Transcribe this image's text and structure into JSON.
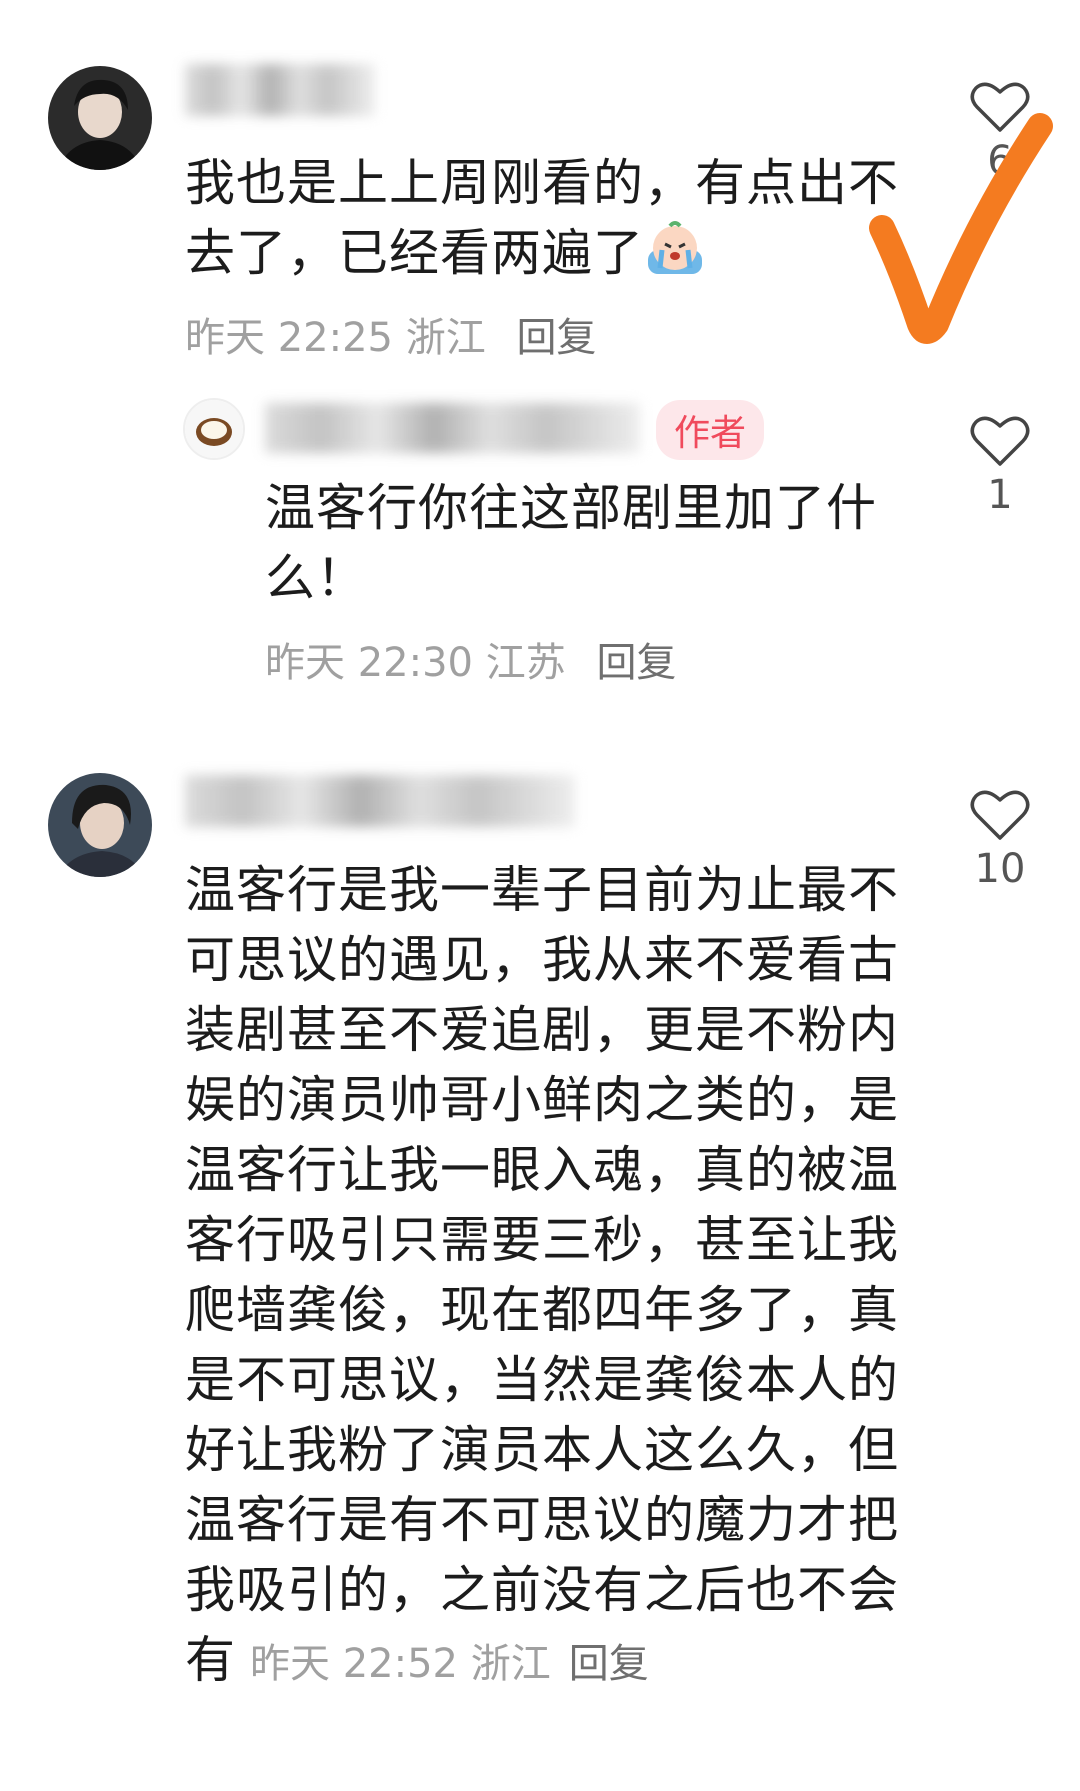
{
  "comments": [
    {
      "content": "我也是上上周刚看的，有点出不去了，已经看两遍了",
      "emoji": "crying-face-emoji",
      "time": "昨天 22:25",
      "location": "浙江",
      "reply_label": "回复",
      "likes": "6"
    },
    {
      "author_tag": "作者",
      "content": "温客行你往这部剧里加了什么！",
      "time": "昨天 22:30",
      "location": "江苏",
      "reply_label": "回复",
      "likes": "1"
    },
    {
      "content": "温客行是我一辈子目前为止最不可思议的遇见，我从来不爱看古装剧甚至不爱追剧，更是不粉内娱的演员帅哥小鲜肉之类的，是温客行让我一眼入魂，真的被温客行吸引只需要三秒，甚至让我爬墙龚俊，现在都四年多了，真是不可思议，当然是龚俊本人的好让我粉了演员本人这么久，但温客行是有不可思议的魔力才把我吸引的，之前没有之后也不会有",
      "time": "昨天 22:52",
      "location": "浙江",
      "reply_label": "回复",
      "likes": "10"
    }
  ],
  "colors": {
    "checkmark": "#f47b20",
    "author_tag_bg": "#fde7ea",
    "author_tag_text": "#f04a5c"
  }
}
